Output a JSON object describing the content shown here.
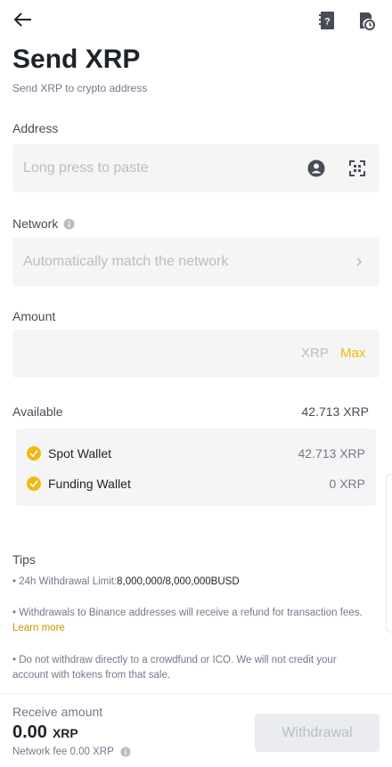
{
  "header": {
    "title": "Send XRP",
    "subtitle": "Send XRP to crypto address"
  },
  "address": {
    "label": "Address",
    "placeholder": "Long press to paste"
  },
  "network": {
    "label": "Network",
    "placeholder": "Automatically match the network"
  },
  "amount": {
    "label": "Amount",
    "unit": "XRP",
    "max_label": "Max"
  },
  "available": {
    "label": "Available",
    "value": "42.713 XRP",
    "wallets": [
      {
        "name": "Spot Wallet",
        "value": "42.713 XRP"
      },
      {
        "name": "Funding Wallet",
        "value": "0 XRP"
      }
    ]
  },
  "tips": {
    "title": "Tips",
    "limit_prefix": "• 24h Withdrawal Limit:",
    "limit_value": "8,000,000/8,000,000BUSD",
    "refund_text": "• Withdrawals to Binance addresses will receive a refund for transaction fees.",
    "refund_link": "Learn more",
    "ico_text": "• Do not withdraw directly to a crowdfund or ICO. We will not credit your account with tokens from that sale."
  },
  "footer": {
    "receive_label": "Receive amount",
    "receive_value": "0.00",
    "receive_unit": "XRP",
    "fee_text": "Network fee 0.00 XRP",
    "withdraw_label": "Withdrawal"
  },
  "colors": {
    "accent": "#f0b90b",
    "link": "#c99400",
    "muted": "#707a8a"
  },
  "icons": [
    "back-arrow-icon",
    "faq-book-icon",
    "history-icon",
    "contact-icon",
    "scan-icon",
    "info-icon",
    "chevron-right-icon",
    "check-circle-icon"
  ]
}
